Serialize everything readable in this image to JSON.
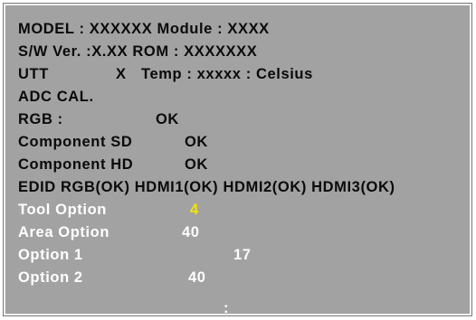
{
  "lines": {
    "model": "MODEL : XXXXXX  Module : XXXX",
    "sw": "S/W Ver. :X.XX    ROM : XXXXXXX",
    "utt_label": "UTT",
    "utt_value": "X",
    "temp": "Temp :  xxxxx : Celsius",
    "adc": "ADC CAL.",
    "rgb_label": "RGB :",
    "rgb_value": "OK",
    "comp_sd_label": "Component SD",
    "comp_sd_value": "OK",
    "comp_hd_label": "Component HD",
    "comp_hd_value": "OK",
    "edid": "EDID   RGB(OK) HDMI1(OK) HDMI2(OK) HDMI3(OK)"
  },
  "options": [
    {
      "label": "Tool Option",
      "value": "4"
    },
    {
      "label": "Area Option",
      "value": "40"
    },
    {
      "label": "Option 1",
      "value": "17"
    },
    {
      "label": "Option 2",
      "value": "40"
    }
  ],
  "footer": ":",
  "colors": {
    "background": "#a2a2a2",
    "text_dark": "#0a0a0a",
    "text_light": "#ffffff",
    "highlight": "#f2e600"
  }
}
